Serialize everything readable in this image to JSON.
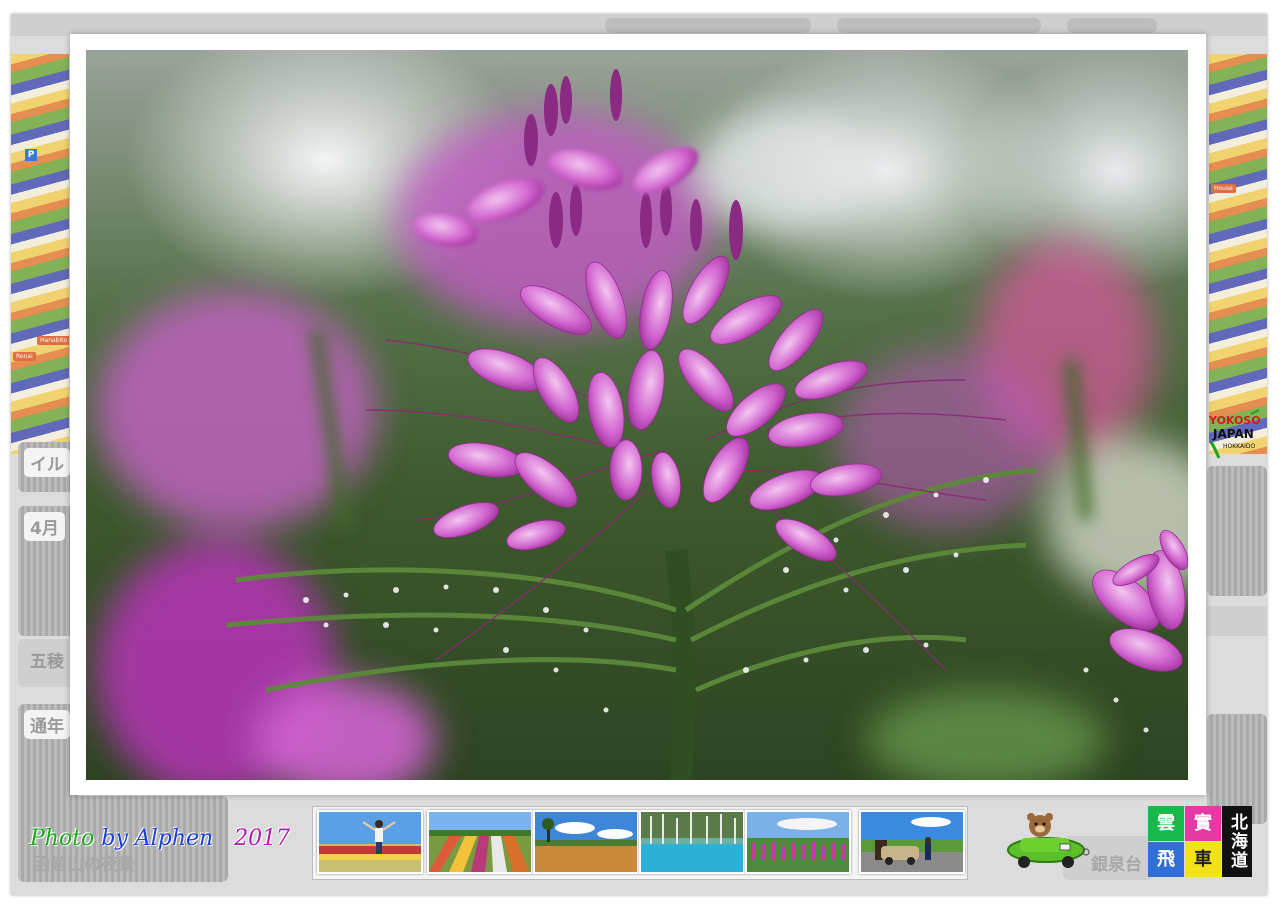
{
  "background_page": {
    "cards": [
      {
        "label": "イル"
      },
      {
        "label": "4月"
      },
      {
        "label": "五稜"
      },
      {
        "label": "通年"
      }
    ],
    "bottom_left_caption": "函館山の夜景",
    "bottom_right_caption": "銀泉台",
    "map_pin": "P",
    "map_tags": [
      "Hanabito",
      "Renai",
      "House"
    ]
  },
  "credit": {
    "word1": "Photo",
    "word2": "by Alphen",
    "year": "2017"
  },
  "thumbnails": [
    {
      "name": "thumb-person-flower-field",
      "desc_icon": "person-icon"
    },
    {
      "name": "thumb-rainbow-fields"
    },
    {
      "name": "thumb-wheat-field-tree"
    },
    {
      "name": "thumb-blue-pond"
    },
    {
      "name": "thumb-lupine-field"
    },
    {
      "name": "thumb-car-road"
    }
  ],
  "logo": {
    "line1": "YOKOSO",
    "line2": "JAPAN",
    "line3": "HOKKAIDO"
  },
  "badge": {
    "cell1": "雲",
    "cell2": "實",
    "cell3": "飛",
    "cell4": "車",
    "vertical": "北海道"
  },
  "colors": {
    "credit_green": "#1aa81a",
    "credit_blue": "#1a3fd6",
    "credit_purple": "#b01ab0",
    "flower_magenta": "#c844c8"
  }
}
